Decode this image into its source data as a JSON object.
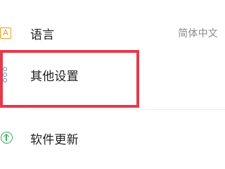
{
  "settings": {
    "language": {
      "icon": "language-icon",
      "icon_glyph": "A",
      "label": "语言",
      "value": "简体中文"
    },
    "other_settings": {
      "icon": "more-options-icon",
      "label": "其他设置"
    },
    "software_update": {
      "icon": "upload-update-icon",
      "label": "软件更新"
    }
  },
  "colors": {
    "language_icon": "#f39a1e",
    "other_settings_icon": "#5b8ed8",
    "update_icon": "#3faa59",
    "highlight": "#e53a4b",
    "text_primary": "#202020",
    "text_secondary": "#8a8a8a"
  }
}
